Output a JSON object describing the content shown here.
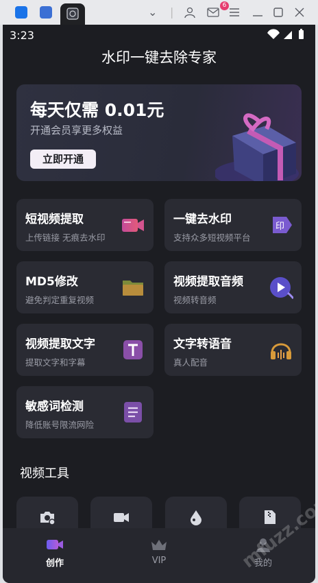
{
  "status": {
    "time": "3:23"
  },
  "topbar": {
    "badge": "6"
  },
  "title": "水印一键去除专家",
  "banner": {
    "title": "每天仅需 0.01元",
    "subtitle": "开通会员享更多权益",
    "button": "立即开通"
  },
  "features": [
    {
      "title": "短视频提取",
      "sub": "上传链接 无痕去水印",
      "icon": "video-camera-icon"
    },
    {
      "title": "一键去水印",
      "sub": "支持众多短视频平台",
      "icon": "stamp-icon"
    },
    {
      "title": "MD5修改",
      "sub": "避免判定重复视频",
      "icon": "folder-icon"
    },
    {
      "title": "视频提取音频",
      "sub": "视频转音频",
      "icon": "audio-disc-icon"
    },
    {
      "title": "视频提取文字",
      "sub": "提取文字和字幕",
      "icon": "text-t-icon"
    },
    {
      "title": "文字转语音",
      "sub": "真人配音",
      "icon": "headphones-icon"
    },
    {
      "title": "敏感词检测",
      "sub": "降低账号限流网险",
      "icon": "document-list-icon"
    }
  ],
  "section_title": "视频工具",
  "tabs": [
    {
      "label": "创作",
      "icon": "video-create-icon"
    },
    {
      "label": "VIP",
      "icon": "crown-icon"
    },
    {
      "label": "我的",
      "icon": "person-icon"
    }
  ],
  "watermark": "mfuzz.com 趣网"
}
